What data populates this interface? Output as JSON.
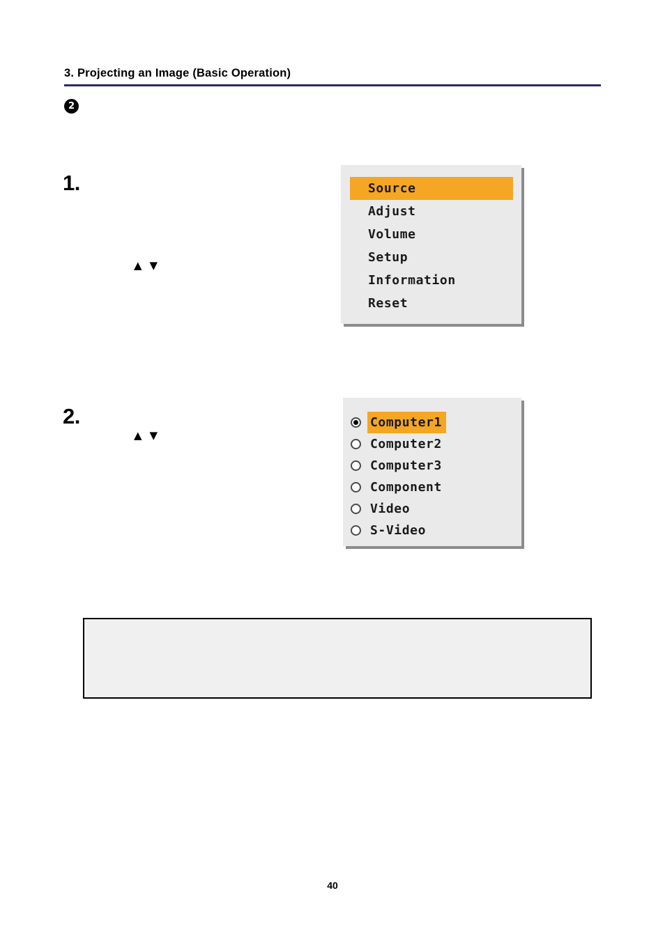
{
  "header": {
    "title": "3. Projecting an Image (Basic Operation)",
    "rule_color": "#2a2a66"
  },
  "section": {
    "bullet": "2"
  },
  "steps": [
    {
      "number": "1.",
      "arrows": "▲▼"
    },
    {
      "number": "2.",
      "arrows": "▲▼"
    }
  ],
  "osd_menu": {
    "highlight_color": "#f5a623",
    "panel_color": "#eaeaea",
    "items": [
      {
        "label": "Source",
        "selected": true
      },
      {
        "label": "Adjust",
        "selected": false
      },
      {
        "label": "Volume",
        "selected": false
      },
      {
        "label": "Setup",
        "selected": false
      },
      {
        "label": "Information",
        "selected": false
      },
      {
        "label": "Reset",
        "selected": false
      }
    ]
  },
  "osd_source": {
    "highlight_color": "#f5a623",
    "panel_color": "#eaeaea",
    "items": [
      {
        "label": "Computer1",
        "selected": true
      },
      {
        "label": "Computer2",
        "selected": false
      },
      {
        "label": "Computer3",
        "selected": false
      },
      {
        "label": "Component",
        "selected": false
      },
      {
        "label": "Video",
        "selected": false
      },
      {
        "label": "S-Video",
        "selected": false
      }
    ]
  },
  "note_box": {
    "text": ""
  },
  "footer": {
    "page_number": "40"
  }
}
